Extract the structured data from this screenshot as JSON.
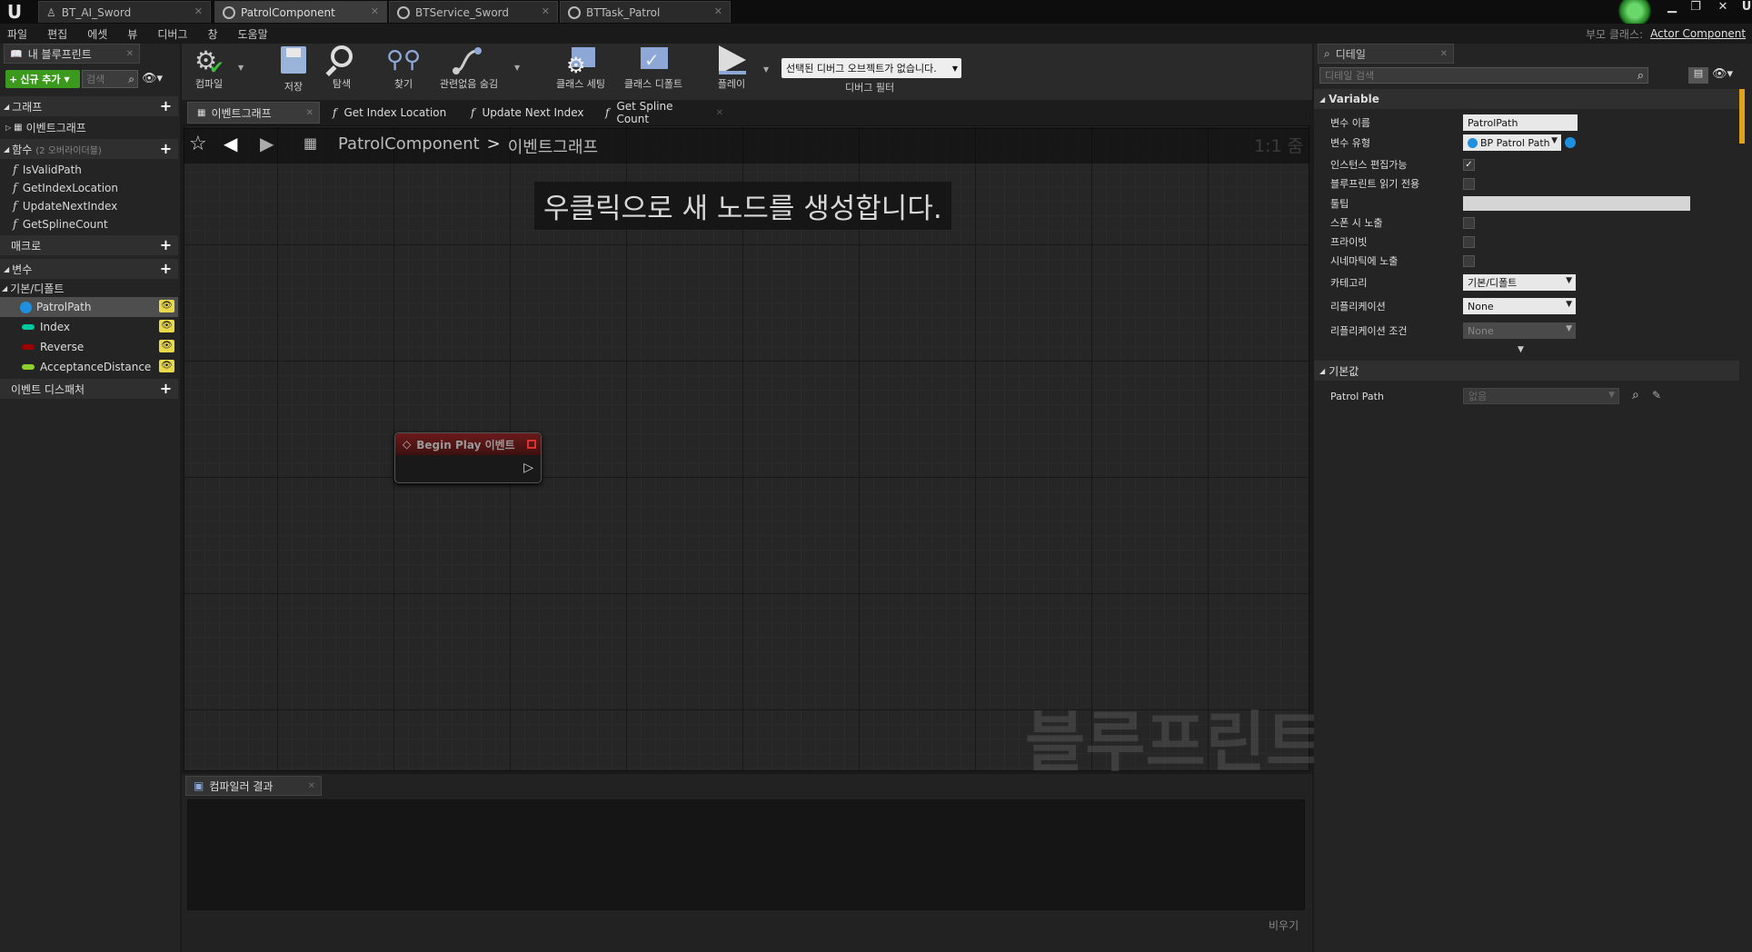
{
  "doc_tabs": [
    {
      "label": "BT_AI_Sword",
      "active": false
    },
    {
      "label": "PatrolComponent",
      "active": true
    },
    {
      "label": "BTService_Sword",
      "active": false
    },
    {
      "label": "BTTask_Patrol",
      "active": false
    }
  ],
  "menu": [
    "파일",
    "편집",
    "에셋",
    "뷰",
    "디버그",
    "창",
    "도움말"
  ],
  "parent_class": {
    "label": "부모 클래스:",
    "value": "Actor Component"
  },
  "my_blueprint": {
    "title": "내 블루프린트",
    "add_new_label": "신규 추가",
    "search_placeholder": "검색",
    "graphs_header": "그래프",
    "event_graph_item": "이벤트그래프",
    "functions_header": "함수",
    "functions_override": "(2 오버라이더블)",
    "functions": [
      "IsValidPath",
      "GetIndexLocation",
      "UpdateNextIndex",
      "GetSplineCount"
    ],
    "macros_header": "매크로",
    "variables_header": "변수",
    "variable_category": "기본/디폴트",
    "variables": [
      {
        "name": "PatrolPath",
        "color": "#1f8fe0"
      },
      {
        "name": "Index",
        "color": "#00c9a0"
      },
      {
        "name": "Reverse",
        "color": "#9a0000"
      },
      {
        "name": "AcceptanceDistance",
        "color": "#8dd02d"
      }
    ],
    "dispatchers_header": "이벤트 디스패처"
  },
  "toolbar": {
    "compile": "컴파일",
    "save": "저장",
    "browse": "탐색",
    "find": "찾기",
    "hide_unrelated": "관련없음 숨김",
    "class_settings": "클래스 세팅",
    "class_defaults": "클래스 디폴트",
    "play": "플레이",
    "debug_object": "선택된 디버그 오브젝트가 없습니다.",
    "debug_filter": "디버그 필터"
  },
  "graph_tabs": [
    "이벤트그래프",
    "Get Index Location",
    "Update Next Index",
    "Get Spline Count"
  ],
  "breadcrumb": {
    "root": "PatrolComponent",
    "separator": ">",
    "current": "이벤트그래프"
  },
  "zoom": "1:1 줌",
  "hint": "우클릭으로 새 노드를 생성합니다.",
  "watermark": "블루프린트",
  "node": {
    "title": "Begin Play 이벤트"
  },
  "compiler": {
    "tab": "컴파일러 결과",
    "clear": "비우기"
  },
  "details": {
    "title": "디테일",
    "search_placeholder": "디테일 검색",
    "variable_section": "Variable",
    "rows": {
      "var_name_label": "변수 이름",
      "var_name_value": "PatrolPath",
      "var_type_label": "변수 유형",
      "var_type_value": "BP Patrol Path",
      "instance_editable_label": "인스턴스 편집가능",
      "instance_editable": true,
      "bp_readonly_label": "블루프린트 읽기 전용",
      "bp_readonly": false,
      "tooltip_label": "툴팁",
      "tooltip_value": "",
      "expose_spawn_label": "스폰 시 노출",
      "expose_spawn": false,
      "private_label": "프라이빗",
      "private": false,
      "expose_cinematics_label": "시네마틱에 노출",
      "expose_cinematics": false,
      "category_label": "카테고리",
      "category_value": "기본/디폴트",
      "replication_label": "리플리케이션",
      "replication_value": "None",
      "rep_condition_label": "리플리케이션 조건",
      "rep_condition_value": "None"
    },
    "default_section": "기본값",
    "default_row_label": "Patrol Path",
    "default_row_value": "없음"
  }
}
